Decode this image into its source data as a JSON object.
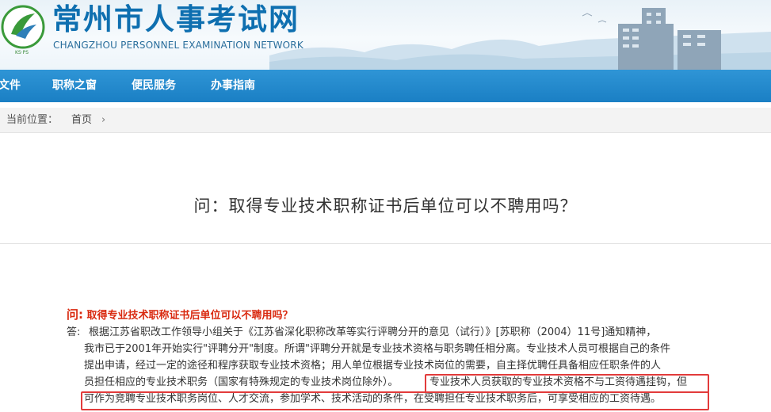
{
  "header": {
    "title": "常州市人事考试网",
    "subtitle": "CHANGZHOU PERSONNEL EXAMINATION NETWORK",
    "logo_text": "KS·PS"
  },
  "nav": {
    "items": [
      {
        "label": "文件"
      },
      {
        "label": "职称之窗"
      },
      {
        "label": "便民服务"
      },
      {
        "label": "办事指南"
      }
    ]
  },
  "breadcrumb": {
    "label": "当前位置：",
    "home": "首页",
    "arrow": "›"
  },
  "article": {
    "title": "问：取得专业技术职称证书后单位可以不聘用吗？",
    "question_prefix": "问:",
    "question_text": "取得专业技术职称证书后单位可以不聘用吗？",
    "answer_prefix": "答:",
    "answer_lines": [
      "根据江苏省职改工作领导小组关于《江苏省深化职称改革等实行评聘分开的意见（试行）》[苏职称（2004）11号]通知精神，",
      "我市已于2001年开始实行\"评聘分开\"制度。所谓\"评聘分开就是专业技术资格与职务聘任相分离。专业技术人员可根据自己的条件",
      "提出申请，经过一定的途径和程序获取专业技术资格；用人单位根据专业技术岗位的需要，自主择优聘任具备相应任职条件的人",
      "员担任相应的专业技术职务（国家有特殊规定的专业技术岗位除外）。",
      "可作为竞聘专业技术职务岗位、人才交流，参加学术、技术活动的条件，在受聘担任专业技术职务后，可享受相应的工资待遇。"
    ],
    "highlight_line4_tail": "专业技术人员获取的专业技术资格不与工资待遇挂钩，但"
  },
  "colors": {
    "nav_bg": "#1a7fc4",
    "title_blue": "#0e6fb0",
    "question_red": "#d9290f",
    "highlight_border": "#e23b3b"
  }
}
